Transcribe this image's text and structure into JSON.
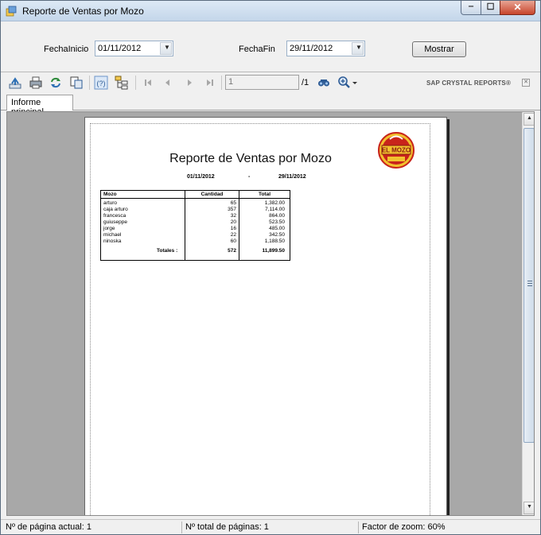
{
  "window": {
    "title": "Reporte de Ventas por Mozo",
    "controls": {
      "minimize": "‒",
      "maximize": "☐",
      "close": "✕"
    }
  },
  "params": {
    "start_label": "FechaInicio",
    "start_value": "01/11/2012",
    "end_label": "FechaFin",
    "end_value": "29/11/2012",
    "show_button": "Mostrar"
  },
  "toolbar": {
    "icons": [
      "export-icon",
      "print-icon",
      "refresh-icon",
      "copy-icon",
      "help-icon",
      "group-tree-icon",
      "first-page-icon",
      "prev-page-icon",
      "next-page-icon",
      "last-page-icon",
      "find-icon",
      "zoom-icon"
    ],
    "page_current": "1",
    "page_total": "/1",
    "brand": "SAP CRYSTAL REPORTS®",
    "close_glyph": "✕"
  },
  "tabs": {
    "main": "Informe principal"
  },
  "report": {
    "title": "Reporte de Ventas por Mozo",
    "date_from": "01/11/2012",
    "date_sep": "-",
    "date_to": "29/11/2012",
    "logo_text": "EL MOZO",
    "columns": [
      "Mozo",
      "Cantidad",
      "Total"
    ],
    "rows": [
      {
        "mozo": "arturo",
        "cantidad": "65",
        "total": "1,382.00"
      },
      {
        "mozo": "caja arturo",
        "cantidad": "357",
        "total": "7,114.00"
      },
      {
        "mozo": "francesca",
        "cantidad": "32",
        "total": "864.00"
      },
      {
        "mozo": "guiuseppe",
        "cantidad": "20",
        "total": "523.50"
      },
      {
        "mozo": "jorge",
        "cantidad": "16",
        "total": "485.00"
      },
      {
        "mozo": "michael",
        "cantidad": "22",
        "total": "342.50"
      },
      {
        "mozo": "ninoska",
        "cantidad": "60",
        "total": "1,188.50"
      }
    ],
    "totals_label": "Totales :",
    "totals_cantidad": "572",
    "totals_total": "11,899.50"
  },
  "status": {
    "current_page": "Nº de página actual: 1",
    "total_pages": "Nº total de páginas: 1",
    "zoom": "Factor de zoom: 60%"
  },
  "colors": {
    "titlebar": "#c4d6ea",
    "viewer_bg": "#a8a8a8",
    "toolbar_icon": "#2d6fb4",
    "logo_red": "#c8241b",
    "logo_gold": "#f2c12e"
  }
}
